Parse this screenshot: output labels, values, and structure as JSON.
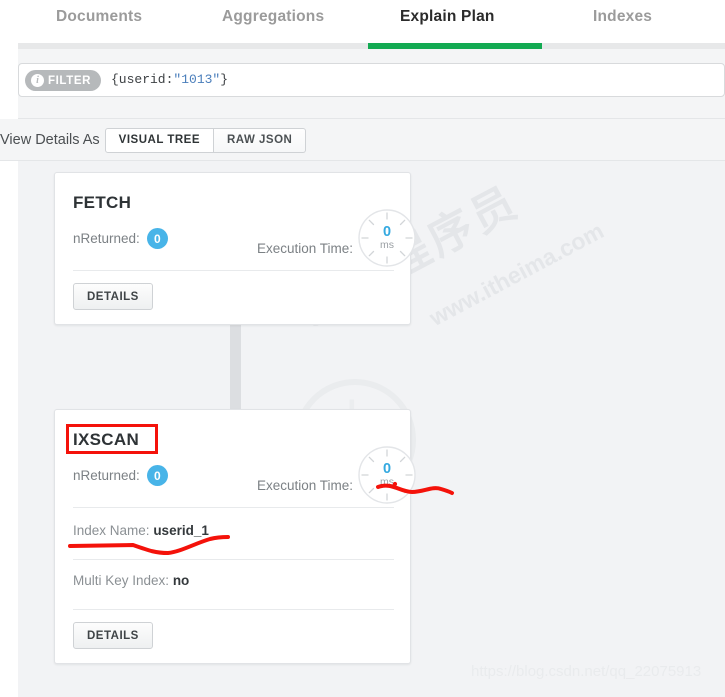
{
  "tabs": [
    {
      "label": "Documents",
      "active": false
    },
    {
      "label": "Aggregations",
      "active": false
    },
    {
      "label": "Explain Plan",
      "active": true
    },
    {
      "label": "Indexes",
      "active": false
    }
  ],
  "filter": {
    "badge_label": "FILTER",
    "badge_icon": "info-icon",
    "expression_prefix": "{userid:",
    "expression_value": "\"1013\"",
    "expression_suffix": "}"
  },
  "view_details": {
    "label": "View Details As",
    "options": [
      {
        "label": "VISUAL TREE",
        "selected": true
      },
      {
        "label": "RAW JSON",
        "selected": false
      }
    ]
  },
  "plan": {
    "nodes": [
      {
        "title": "FETCH",
        "nreturned_label": "nReturned:",
        "nreturned_value": "0",
        "exec_label": "Execution Time:",
        "exec_value": "0",
        "exec_unit": "ms",
        "details_label": "DETAILS",
        "fields": []
      },
      {
        "title": "IXSCAN",
        "nreturned_label": "nReturned:",
        "nreturned_value": "0",
        "exec_label": "Execution Time:",
        "exec_value": "0",
        "exec_unit": "ms",
        "details_label": "DETAILS",
        "fields": [
          {
            "key": "Index Name:",
            "value": "userid_1"
          },
          {
            "key": "Multi Key Index:",
            "value": "no"
          }
        ]
      }
    ]
  },
  "watermarks": {
    "cn_text": "黑马程序员",
    "url_text": "www.itheima.com",
    "footer_text": "https://blog.csdn.net/qq_22075913"
  },
  "colors": {
    "accent_green": "#13aa52",
    "badge_blue": "#48b4e8",
    "annotation_red": "#f4120a",
    "canvas_bg": "#f2f3f5"
  }
}
